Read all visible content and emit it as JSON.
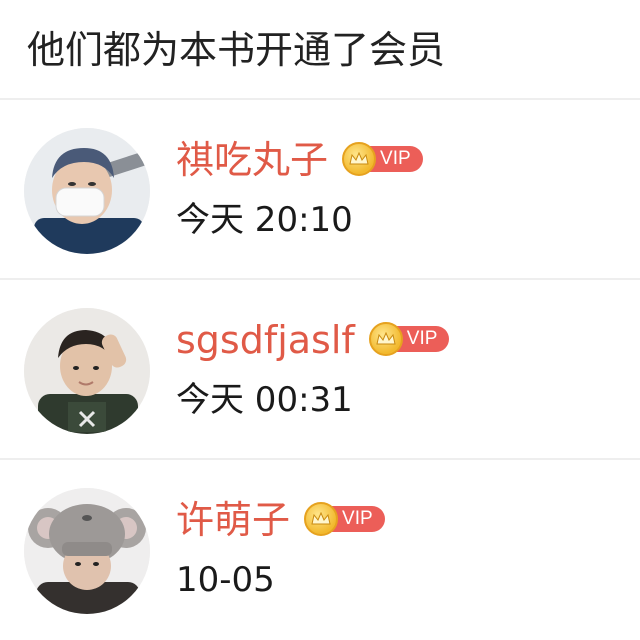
{
  "header": {
    "title": "他们都为本书开通了会员"
  },
  "members": [
    {
      "name": "祺吃丸子",
      "vip_label": "VIP",
      "time": "今天 20:10"
    },
    {
      "name": "sgsdfjaslf",
      "vip_label": "VIP",
      "time": "今天 00:31"
    },
    {
      "name": "许萌子",
      "vip_label": "VIP",
      "time": "10-05"
    }
  ],
  "colors": {
    "name": "#e05a47",
    "vip_tag": "#ec5e58",
    "crown": "#f2b92e",
    "divider": "#eeeeee"
  }
}
